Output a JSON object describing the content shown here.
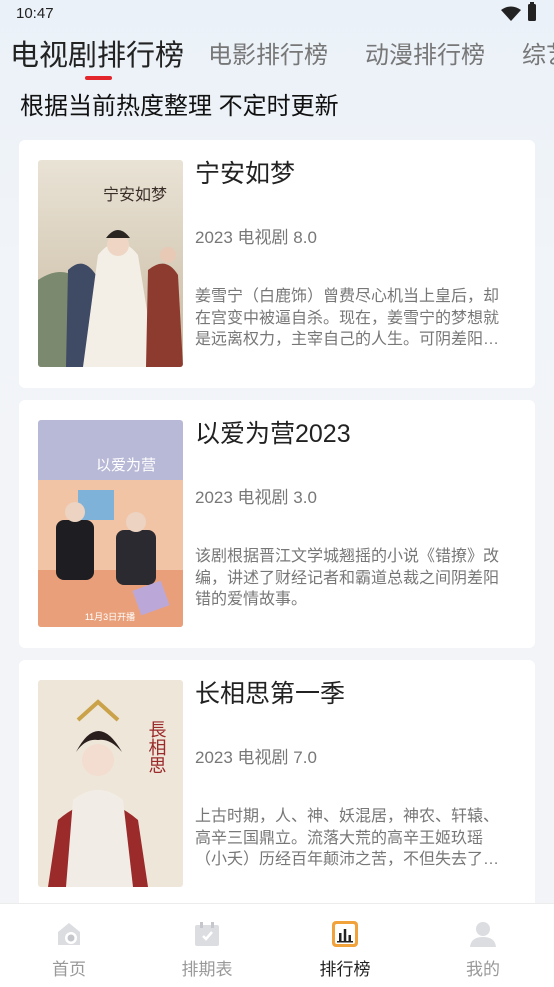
{
  "status_bar": {
    "time": "10:47"
  },
  "tabs": [
    {
      "label": "电视剧排行榜",
      "active": true
    },
    {
      "label": "电影排行榜",
      "active": false
    },
    {
      "label": "动漫排行榜",
      "active": false
    },
    {
      "label": "综艺排行榜",
      "active": false
    }
  ],
  "subtitle": "根据当前热度整理  不定时更新",
  "list": [
    {
      "title": "宁安如梦",
      "meta": "2023 电视剧 8.0",
      "description": "姜雪宁（白鹿饰）曾费尽心机当上皇后，却在宫变中被逼自杀。现在，姜雪宁的梦想就是远离权力，主宰自己的人生。可阴差阳错她还是入宫做了伴读，遇到了前世的仇人和恩人……",
      "poster_text": "宁安如梦"
    },
    {
      "title": "以爱为营2023",
      "meta": "2023 电视剧 3.0",
      "description": "该剧根据晋江文学城翘摇的小说《错撩》改编，讲述了财经记者和霸道总裁之间阴差阳错的爱情故事。",
      "poster_text": "以爱为营",
      "poster_caption": "11月3日开播"
    },
    {
      "title": "长相思第一季",
      "meta": "2023 电视剧 7.0",
      "description": "上古时期，人、神、妖混居，神农、轩辕、高辛三国鼎立。流落大荒的高辛王姬玖瑶（小夭）历经百年颠沛之苦，不但失去了身份，也失去了容貌，在清水镇隐姓埋名……",
      "poster_text": "長相思"
    }
  ],
  "bottom_nav": [
    {
      "label": "首页",
      "icon": "home-icon",
      "active": false
    },
    {
      "label": "排期表",
      "icon": "calendar-icon",
      "active": false
    },
    {
      "label": "排行榜",
      "icon": "chart-icon",
      "active": true
    },
    {
      "label": "我的",
      "icon": "user-icon",
      "active": false
    }
  ],
  "colors": {
    "accent": "#e3262b",
    "active_icon": "#f2a23a",
    "background": "#f3f4f7"
  }
}
